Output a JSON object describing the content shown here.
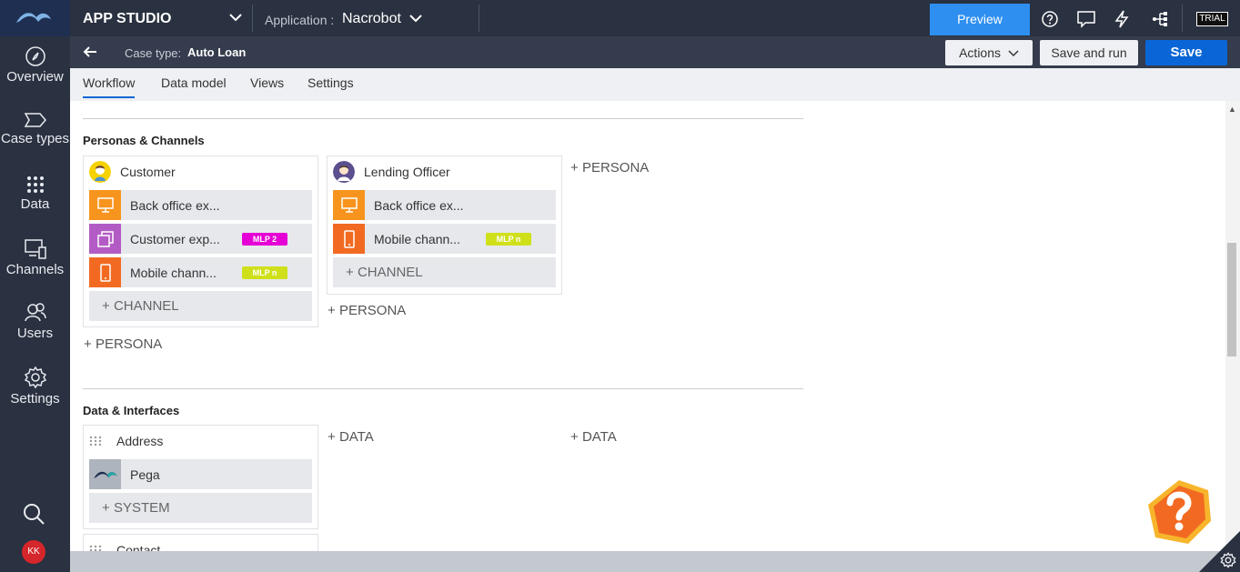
{
  "sidebar": {
    "items": [
      {
        "label": "Overview",
        "icon": "compass-icon"
      },
      {
        "label": "Case types",
        "icon": "case-tag-icon"
      },
      {
        "label": "Data",
        "icon": "grid-dots-icon"
      },
      {
        "label": "Channels",
        "icon": "devices-icon"
      },
      {
        "label": "Users",
        "icon": "users-icon"
      },
      {
        "label": "Settings",
        "icon": "gear-icon"
      }
    ],
    "avatar_initials": "KK"
  },
  "topbar": {
    "app_studio": "APP STUDIO",
    "application_label": "Application :",
    "application_name": "Nacrobot",
    "preview": "Preview",
    "trial": "TRIAL"
  },
  "header": {
    "case_type_label": "Case type:",
    "case_type_name": "Auto Loan",
    "actions": "Actions",
    "save_and_run": "Save and run",
    "save": "Save"
  },
  "tabs": [
    {
      "label": "Workflow",
      "active": true
    },
    {
      "label": "Data model",
      "active": false
    },
    {
      "label": "Views",
      "active": false
    },
    {
      "label": "Settings",
      "active": false
    }
  ],
  "personas_section": {
    "title": "Personas & Channels",
    "personas": [
      {
        "name": "Customer",
        "channels": [
          {
            "label": "Back office ex...",
            "color": "#f7941d",
            "icon": "monitor-icon"
          },
          {
            "label": "Customer exp...",
            "color": "#b35bc4",
            "icon": "layers-icon",
            "badge": "MLP 2",
            "badge_color": "#e500d5",
            "badge_text_color": "#ffffff"
          },
          {
            "label": "Mobile chann...",
            "color": "#f26a21",
            "icon": "phone-icon",
            "badge": "MLP n",
            "badge_color": "#cfe01a",
            "badge_text_color": "#ffffff"
          }
        ],
        "add_channel": "CHANNEL"
      },
      {
        "name": "Lending Officer",
        "channels": [
          {
            "label": "Back office ex...",
            "color": "#f7941d",
            "icon": "monitor-icon"
          },
          {
            "label": "Mobile chann...",
            "color": "#f26a21",
            "icon": "phone-icon",
            "badge": "MLP n",
            "badge_color": "#cfe01a",
            "badge_text_color": "#ffffff"
          }
        ],
        "add_channel": "CHANNEL"
      }
    ],
    "add_persona": "PERSONA"
  },
  "data_section": {
    "title": "Data & Interfaces",
    "objects": [
      {
        "name": "Address",
        "systems": [
          {
            "label": "Pega",
            "icon": "pega-logo-icon"
          }
        ],
        "add_system": "SYSTEM"
      },
      {
        "name": "Contact"
      }
    ],
    "add_data": "DATA"
  },
  "colors": {
    "sidebar_bg": "#2a3140",
    "preview_bg": "#2e8ff0",
    "save_bg": "#0a66d6",
    "help_fab": "#f26a21"
  }
}
